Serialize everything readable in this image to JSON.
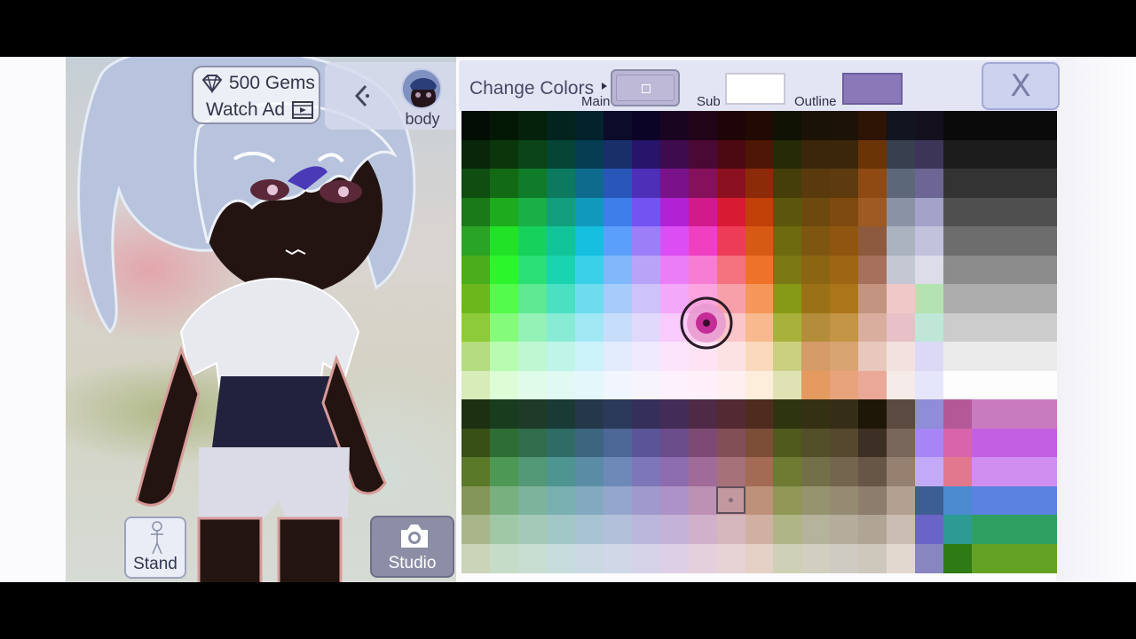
{
  "currency": {
    "gems_label": "500 Gems",
    "watch_ad_label": "Watch Ad"
  },
  "part_selector": {
    "label": "body"
  },
  "tools": [
    "add-character",
    "background",
    "visibility",
    "zoom-in",
    "zoom-out"
  ],
  "bottom_buttons": {
    "stand_label": "Stand",
    "studio_label": "Studio"
  },
  "color_panel": {
    "title": "Change Colors",
    "main_label": "Main",
    "sub_label": "Sub",
    "outline_label": "Outline",
    "main_color": "#b9b5d3",
    "sub_color": "#ffffff",
    "outline_color": "#8a78b9",
    "close_label": "X"
  },
  "palette": {
    "top_block": [
      [
        "#030d03",
        "#031804",
        "#03210b",
        "#02241d",
        "#04222b",
        "#0a0c2a",
        "#0c0427",
        "#1a0520",
        "#220419",
        "#1e0508",
        "#200a03",
        "#101203",
        "#1a1204",
        "#1c1205",
        "#2d1405",
        "#101520",
        "#14101e",
        "#0a0a0a"
      ],
      [
        "#082609",
        "#0b360c",
        "#0a4417",
        "#064536",
        "#073d52",
        "#192f6a",
        "#26156a",
        "#3e0b4f",
        "#4a0834",
        "#4c0912",
        "#4e1604",
        "#262a06",
        "#3a2709",
        "#3b2609",
        "#6b3406",
        "#384050",
        "#3d3558",
        "#1c1c1c"
      ],
      [
        "#0f4d10",
        "#126a14",
        "#0f7c2a",
        "#0c7a5f",
        "#0e6b8e",
        "#2956b9",
        "#4d2fb8",
        "#7a138a",
        "#85105c",
        "#8b1020",
        "#8c2b08",
        "#453e0a",
        "#5a3a0d",
        "#5e3a0f",
        "#8e4a12",
        "#5c687a",
        "#6d6694",
        "#333333"
      ],
      [
        "#1a7a18",
        "#1eac1e",
        "#1ab046",
        "#139e7d",
        "#1198bd",
        "#3d7eeb",
        "#7353f2",
        "#b321d4",
        "#d11a8b",
        "#d91a33",
        "#c04008",
        "#5c560c",
        "#6c490e",
        "#7f4a10",
        "#9e5a22",
        "#8a93a6",
        "#a3a2c9",
        "#4f4f4f"
      ],
      [
        "#2aa425",
        "#22e228",
        "#16d25c",
        "#11c49a",
        "#14bfdf",
        "#5aa0fa",
        "#9b7ef8",
        "#dc4ef3",
        "#f040c2",
        "#ed3c57",
        "#d75a14",
        "#6d6a0f",
        "#7f560f",
        "#905510",
        "#8d5a3d",
        "#abb2c0",
        "#c3c2dd",
        "#6d6d6d"
      ],
      [
        "#4aae1c",
        "#2bf62c",
        "#2be076",
        "#1ad3b0",
        "#3ad0e8",
        "#80b8fb",
        "#b8a3f9",
        "#eb7ef7",
        "#f77dd3",
        "#f5727f",
        "#ef7229",
        "#7c7914",
        "#8c6512",
        "#9e6514",
        "#a7705c",
        "#c3c8d2",
        "#dcdde8",
        "#8c8c8c"
      ],
      [
        "#6cb81c",
        "#52fb4c",
        "#5eea92",
        "#4ae0c2",
        "#6edced",
        "#a6ccfb",
        "#cec2fa",
        "#f3a8fa",
        "#fba4e0",
        "#f8a0a9",
        "#f5975a",
        "#879a17",
        "#9a7215",
        "#ad7519",
        "#c39580",
        "#f0c8c8",
        "#b4e3b0",
        "#adadad"
      ],
      [
        "#8dcb3a",
        "#85fb7c",
        "#94f2b6",
        "#88ebd6",
        "#a1e7f4",
        "#c6ddfc",
        "#e1d9fc",
        "#f8cbfc",
        "#fdc8ec",
        "#fbc6ca",
        "#f8b98e",
        "#a8b23a",
        "#b48d3a",
        "#c49545",
        "#d9ae9f",
        "#e8c0c8",
        "#bfe6d6",
        "#cccccc"
      ],
      [
        "#b5dc80",
        "#b8fcb1",
        "#c0f7d3",
        "#bff4e8",
        "#cbf2f9",
        "#e2ecfd",
        "#efeafd",
        "#fce4fd",
        "#feE3f5",
        "#fde2e4",
        "#fbd9bd",
        "#cad07f",
        "#d59b68",
        "#d8a471",
        "#e8c8bd",
        "#f2e1df",
        "#dcd9f6",
        "#ebebeb"
      ],
      [
        "#d7ecb8",
        "#dcfdd6",
        "#e0fbe9",
        "#e0f9f3",
        "#e4f8fc",
        "#f0f5fe",
        "#f7f4fe",
        "#fef1fe",
        "#fff0fa",
        "#fef0f1",
        "#fdeedb",
        "#dfe3b4",
        "#e59a60",
        "#e6a37c",
        "#eaa898",
        "#f5ebe8",
        "#e6e6fb",
        "#fdfdfd"
      ]
    ],
    "bottom_block": [
      [
        "#1e3012",
        "#193c1e",
        "#1d3b28",
        "#1a3b35",
        "#24384a",
        "#2b3a5b",
        "#352f5b",
        "#432c55",
        "#4f2a46",
        "#532a33",
        "#4f2b1e",
        "#2f3410",
        "#343014",
        "#362d16",
        "#1e1708",
        "#5b4a3f",
        "#8f8cd8",
        "#b55897",
        "#c97bbf"
      ],
      [
        "#385016",
        "#2e6d33",
        "#316d4c",
        "#2e6c65",
        "#3d6580",
        "#4d6796",
        "#5a5596",
        "#6c4d8b",
        "#7d4a73",
        "#824f57",
        "#7c4d37",
        "#4f5a1c",
        "#535029",
        "#55482f",
        "#3c2f24",
        "#78675a",
        "#a885f6",
        "#d865ab",
        "#c35fe3"
      ],
      [
        "#5b7a29",
        "#4e9856",
        "#539877",
        "#4e9490",
        "#5a8ca6",
        "#6d89b8",
        "#7c77b9",
        "#8d6cb0",
        "#a06b98",
        "#a67179",
        "#a36b53",
        "#6f7a32",
        "#737049",
        "#74664e",
        "#675546",
        "#96806f",
        "#c2aaf9",
        "#e1788d",
        "#cf8ef0"
      ],
      [
        "#849758",
        "#78b07f",
        "#7db39b",
        "#79afaf",
        "#83a9c0",
        "#93a6cc",
        "#9f99cd",
        "#ad92c7",
        "#bc91b4",
        "#c3989f",
        "#be917b",
        "#8f9656",
        "#96936f",
        "#958b72",
        "#8c7d6d",
        "#b3a091",
        "#3d5e92",
        "#4b8bd0",
        "#5b82e0"
      ],
      [
        "#a8b68a",
        "#a1c8a6",
        "#a4cab7",
        "#a2c7c7",
        "#a8c3d2",
        "#b3c0da",
        "#bbb6dc",
        "#c5b2d8",
        "#d0b1c9",
        "#d5b7bc",
        "#d0b1a1",
        "#b0b586",
        "#b5b39a",
        "#b5ac9c",
        "#b0a494",
        "#cbbdb2",
        "#6a64c8",
        "#2e9a94",
        "#2fa061"
      ],
      [
        "#cbd3b8",
        "#c5dcc8",
        "#c7ddd2",
        "#c6dcdc",
        "#cad9e1",
        "#d0d7e7",
        "#d6d2e8",
        "#dccfe6",
        "#e4cfdc",
        "#e7d2d5",
        "#e4d0c4",
        "#cdd0b4",
        "#d0cfc0",
        "#d0cbc2",
        "#cec7bc",
        "#e2d8cf",
        "#8886c1",
        "#2e7a14",
        "#63a225"
      ]
    ]
  }
}
